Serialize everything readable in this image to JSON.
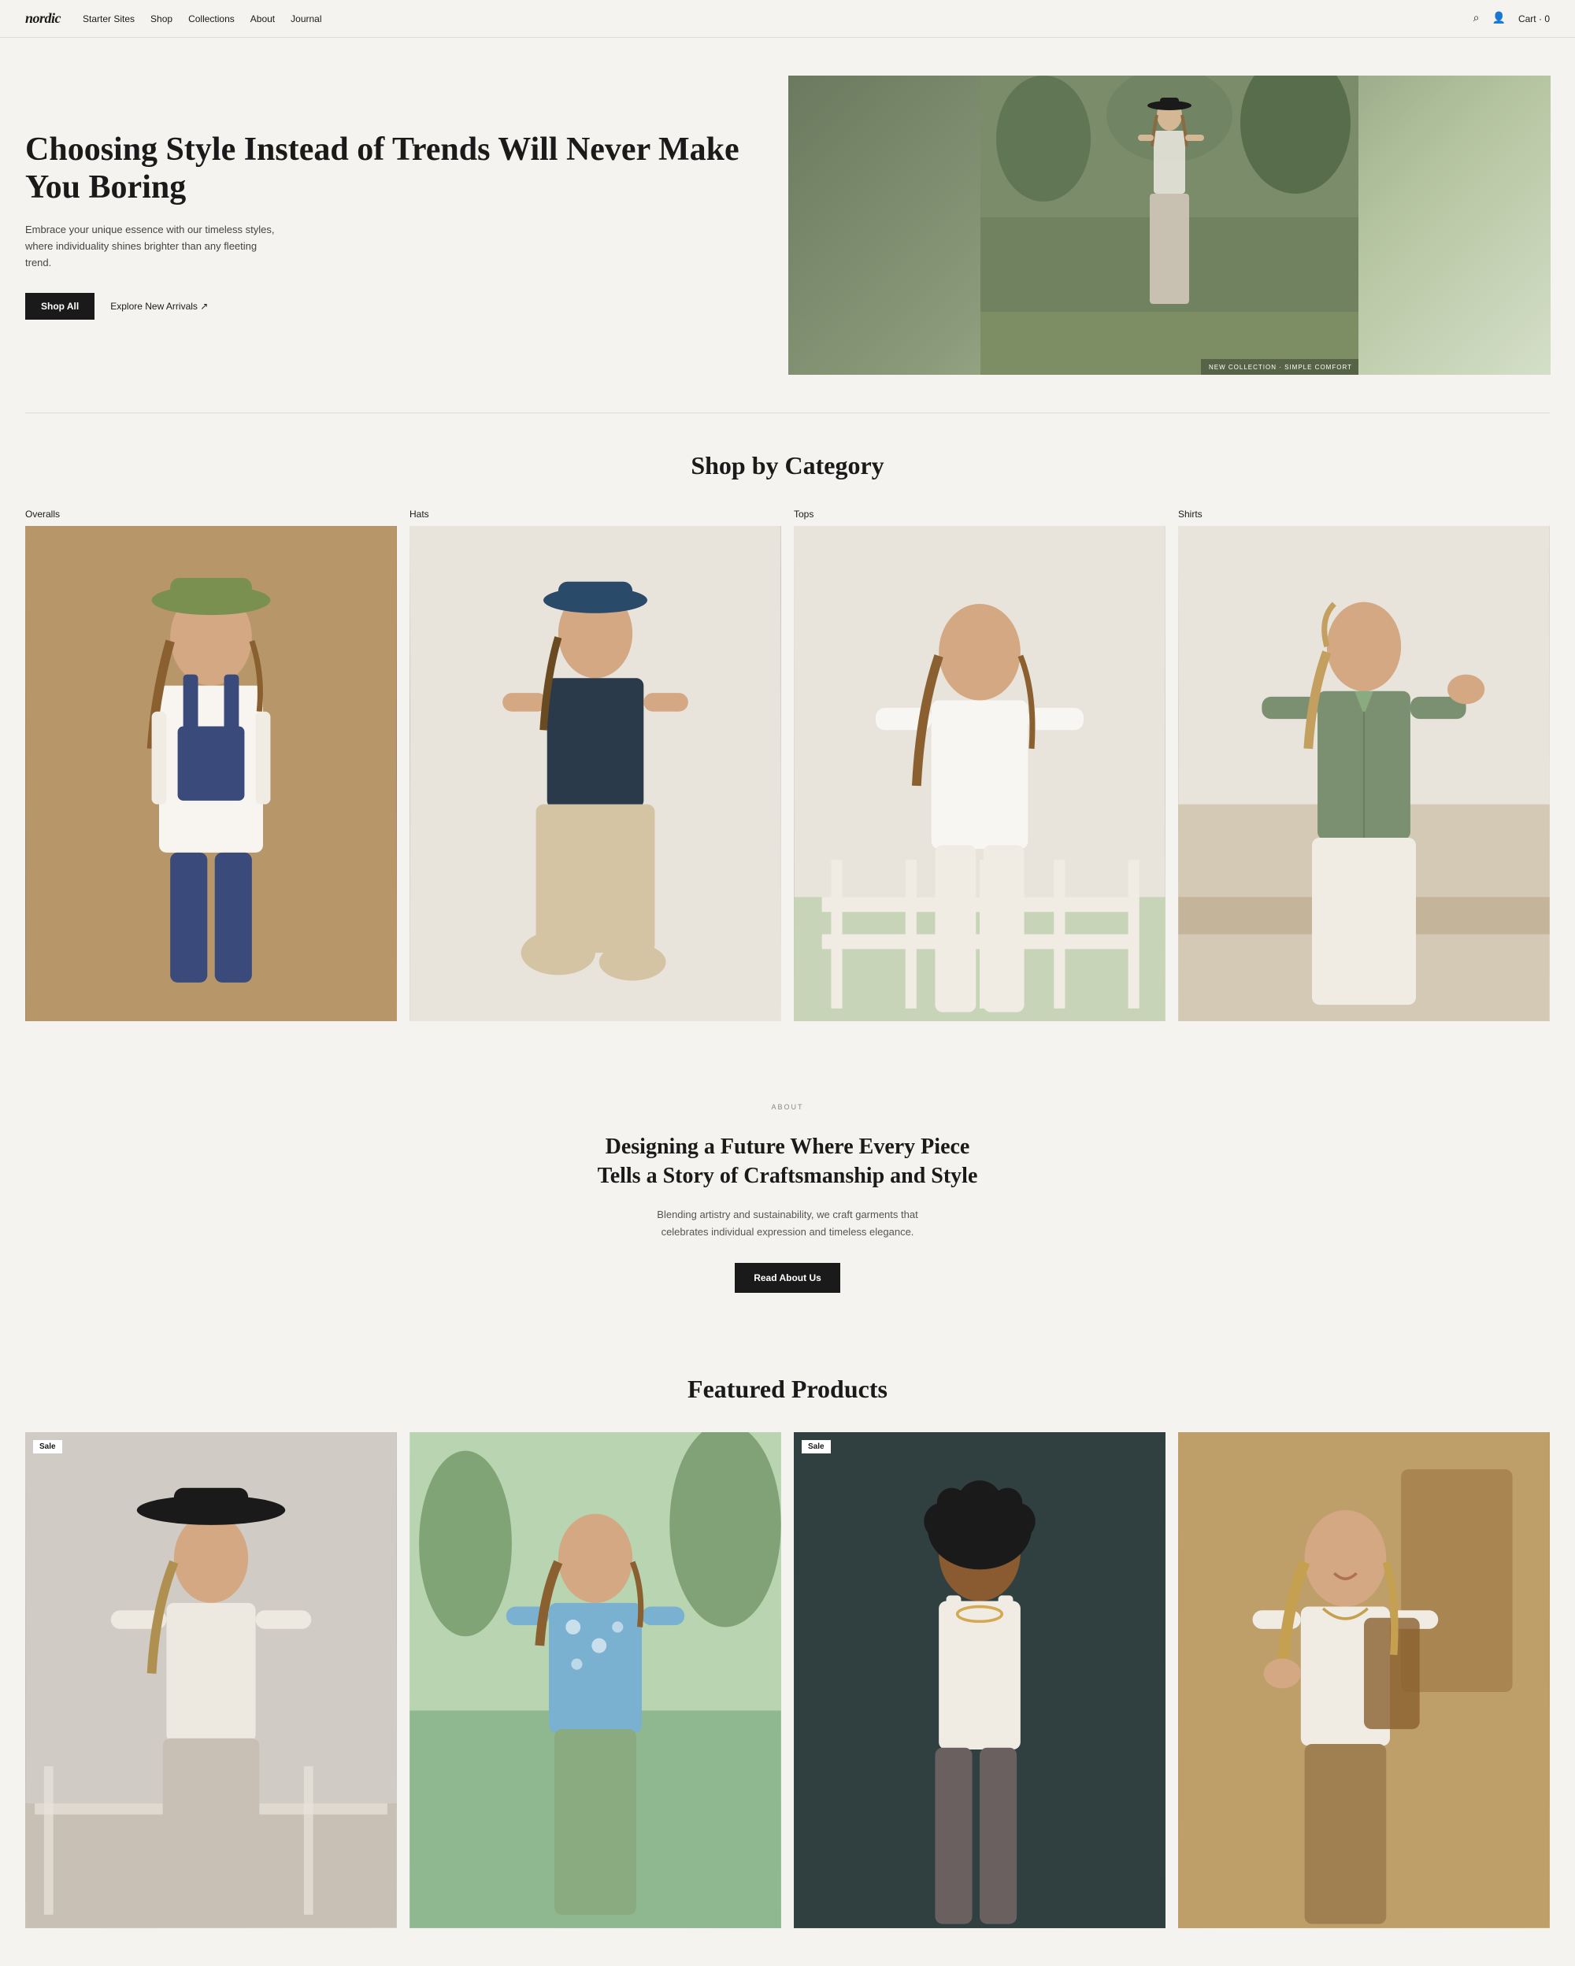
{
  "site": {
    "logo": "nordic",
    "nav": {
      "links": [
        "Starter Sites",
        "Shop",
        "Collections",
        "About",
        "Journal"
      ],
      "cart_label": "Cart",
      "cart_count": "0"
    }
  },
  "hero": {
    "title": "Choosing Style Instead of Trends Will Never Make You Boring",
    "subtitle": "Embrace your unique essence with our timeless styles, where individuality shines brighter than any fleeting trend.",
    "cta_primary": "Shop All",
    "cta_secondary": "Explore New Arrivals ↗",
    "badge": "NEW COLLECTION · SIMPLE COMFORT"
  },
  "shop_category": {
    "heading": "Shop by Category",
    "categories": [
      {
        "label": "Overalls",
        "key": "overalls"
      },
      {
        "label": "Hats",
        "key": "hats"
      },
      {
        "label": "Tops",
        "key": "tops"
      },
      {
        "label": "Shirts",
        "key": "shirts"
      }
    ]
  },
  "about": {
    "tag": "ABOUT",
    "title": "Designing a Future Where Every Piece Tells a Story of Craftsmanship and Style",
    "subtitle": "Blending artistry and sustainability, we craft garments that celebrates individual expression and timeless elegance.",
    "cta": "Read About Us"
  },
  "featured": {
    "heading": "Featured Products",
    "products": [
      {
        "sale": true,
        "key": "prod-1"
      },
      {
        "sale": false,
        "key": "prod-2"
      },
      {
        "sale": true,
        "key": "prod-3"
      },
      {
        "sale": false,
        "key": "prod-4"
      }
    ]
  }
}
